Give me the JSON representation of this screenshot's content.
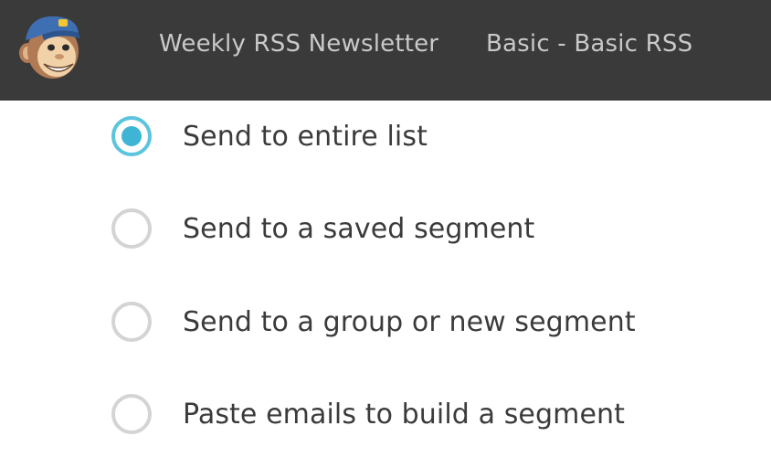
{
  "header": {
    "logo_icon": "chimp-mascot-icon",
    "campaign_name": "Weekly RSS Newsletter",
    "template_name": "Basic - Basic RSS"
  },
  "recipients": {
    "options": [
      {
        "label": "Send to entire list",
        "checked": true
      },
      {
        "label": "Send to a saved segment",
        "checked": false
      },
      {
        "label": "Send to a group or new segment",
        "checked": false
      },
      {
        "label": "Paste emails to build a segment",
        "checked": false
      }
    ]
  },
  "colors": {
    "header_bg": "#3a3a3a",
    "header_text": "#c9c9c9",
    "radio_accent": "#3fb5d6",
    "radio_border": "#d4d4d4"
  }
}
